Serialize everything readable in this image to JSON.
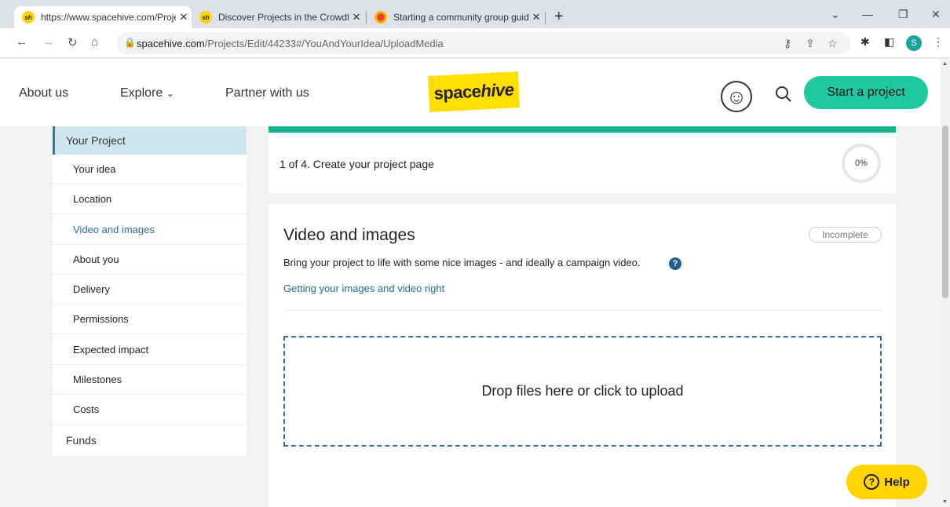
{
  "browser": {
    "tabs": [
      {
        "title": "https://www.spacehive.com/Proje",
        "favicon": "sh"
      },
      {
        "title": "Discover Projects in the Crowdfu",
        "favicon": "sh"
      },
      {
        "title": "Starting a community group guid",
        "favicon": ""
      }
    ],
    "url_host": "spacehive.com",
    "url_path": "/Projects/Edit/44233#/YouAndYourIdea/UploadMedia",
    "profile_initial": "S"
  },
  "header": {
    "about": "About us",
    "explore": "Explore",
    "partner": "Partner with us",
    "logo_main": "space",
    "logo_italic": "hive",
    "start_button": "Start a project"
  },
  "sidebar": {
    "section_project": "Your Project",
    "items": [
      "Your idea",
      "Location",
      "Video and images",
      "About you",
      "Delivery",
      "Permissions",
      "Expected impact",
      "Milestones",
      "Costs"
    ],
    "section_funds": "Funds"
  },
  "step": {
    "text": "1 of 4. Create your project page",
    "progress": "0%"
  },
  "card": {
    "title": "Video and images",
    "status": "Incomplete",
    "description": "Bring your project to life with some nice images - and ideally a campaign video.",
    "help_mark": "?",
    "link": "Getting your images and video right",
    "dropzone": "Drop files here or click to upload"
  },
  "help": {
    "label": "Help",
    "icon_glyph": "?"
  },
  "colors": {
    "accent": "#1ec9a0",
    "brand": "#ffde00",
    "link": "#1f6c96"
  }
}
